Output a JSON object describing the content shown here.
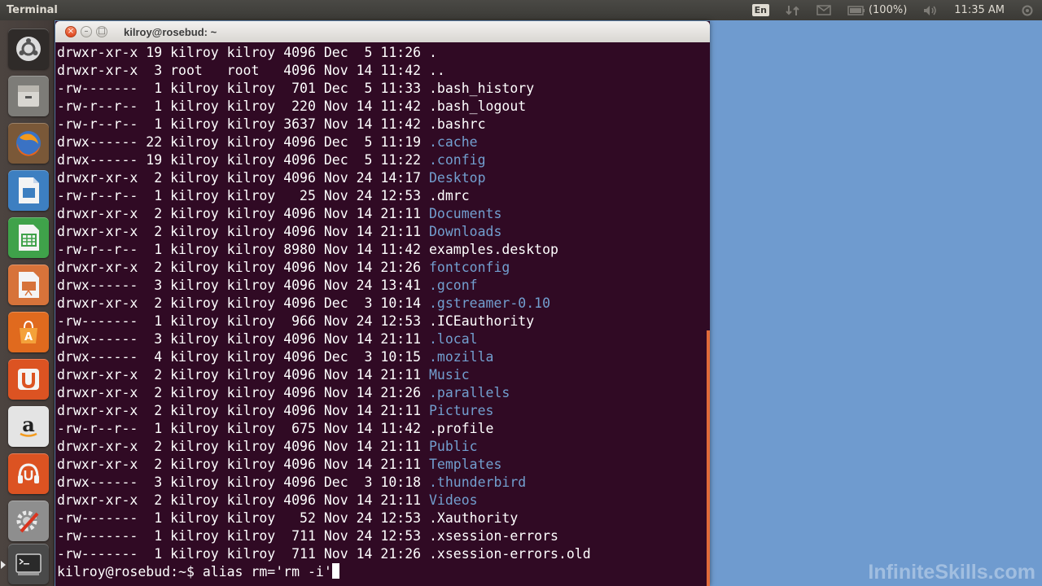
{
  "panel": {
    "app_title": "Terminal",
    "keyboard_layout": "En",
    "battery": "(100%)",
    "clock": "11:35 AM"
  },
  "launcher": {
    "items": [
      {
        "name": "dash-home",
        "icon": "ubuntu-logo-icon",
        "color": "#2b2b2b"
      },
      {
        "name": "files",
        "icon": "file-cabinet-icon",
        "color": "#8a8a86"
      },
      {
        "name": "firefox",
        "icon": "firefox-icon",
        "color": "#d9541f"
      },
      {
        "name": "libreoffice-writer",
        "icon": "writer-document-icon",
        "color": "#3d7fc1"
      },
      {
        "name": "libreoffice-calc",
        "icon": "calc-spreadsheet-icon",
        "color": "#3fa24a"
      },
      {
        "name": "libreoffice-impress",
        "icon": "impress-presentation-icon",
        "color": "#d7733a"
      },
      {
        "name": "software-center",
        "icon": "shopping-bag-icon",
        "color": "#e06a1e"
      },
      {
        "name": "ubuntu-one",
        "icon": "ubuntu-one-icon",
        "color": "#dc5322"
      },
      {
        "name": "amazon",
        "icon": "amazon-icon",
        "color": "#e8e8e8"
      },
      {
        "name": "ubuntu-one-music",
        "icon": "headphones-icon",
        "color": "#dc5322"
      },
      {
        "name": "system-settings",
        "icon": "gear-wrench-icon",
        "color": "#9a9a9a"
      },
      {
        "name": "terminal",
        "icon": "terminal-icon",
        "color": "#3a3a3a"
      }
    ]
  },
  "window": {
    "title": "kilroy@rosebud: ~"
  },
  "terminal": {
    "listing": [
      {
        "perms": "drwxr-xr-x",
        "links": "19",
        "owner": "kilroy",
        "group": "kilroy",
        "size": "4096",
        "date": "Dec  5 11:26",
        "name": ".",
        "is_dir": false
      },
      {
        "perms": "drwxr-xr-x",
        "links": " 3",
        "owner": "root",
        "group": "root",
        "size": "4096",
        "date": "Nov 14 11:42",
        "name": "..",
        "is_dir": false
      },
      {
        "perms": "-rw-------",
        "links": " 1",
        "owner": "kilroy",
        "group": "kilroy",
        "size": " 701",
        "date": "Dec  5 11:33",
        "name": ".bash_history",
        "is_dir": false
      },
      {
        "perms": "-rw-r--r--",
        "links": " 1",
        "owner": "kilroy",
        "group": "kilroy",
        "size": " 220",
        "date": "Nov 14 11:42",
        "name": ".bash_logout",
        "is_dir": false
      },
      {
        "perms": "-rw-r--r--",
        "links": " 1",
        "owner": "kilroy",
        "group": "kilroy",
        "size": "3637",
        "date": "Nov 14 11:42",
        "name": ".bashrc",
        "is_dir": false
      },
      {
        "perms": "drwx------",
        "links": "22",
        "owner": "kilroy",
        "group": "kilroy",
        "size": "4096",
        "date": "Dec  5 11:19",
        "name": ".cache",
        "is_dir": true
      },
      {
        "perms": "drwx------",
        "links": "19",
        "owner": "kilroy",
        "group": "kilroy",
        "size": "4096",
        "date": "Dec  5 11:22",
        "name": ".config",
        "is_dir": true
      },
      {
        "perms": "drwxr-xr-x",
        "links": " 2",
        "owner": "kilroy",
        "group": "kilroy",
        "size": "4096",
        "date": "Nov 24 14:17",
        "name": "Desktop",
        "is_dir": true
      },
      {
        "perms": "-rw-r--r--",
        "links": " 1",
        "owner": "kilroy",
        "group": "kilroy",
        "size": "  25",
        "date": "Nov 24 12:53",
        "name": ".dmrc",
        "is_dir": false
      },
      {
        "perms": "drwxr-xr-x",
        "links": " 2",
        "owner": "kilroy",
        "group": "kilroy",
        "size": "4096",
        "date": "Nov 14 21:11",
        "name": "Documents",
        "is_dir": true
      },
      {
        "perms": "drwxr-xr-x",
        "links": " 2",
        "owner": "kilroy",
        "group": "kilroy",
        "size": "4096",
        "date": "Nov 14 21:11",
        "name": "Downloads",
        "is_dir": true
      },
      {
        "perms": "-rw-r--r--",
        "links": " 1",
        "owner": "kilroy",
        "group": "kilroy",
        "size": "8980",
        "date": "Nov 14 11:42",
        "name": "examples.desktop",
        "is_dir": false
      },
      {
        "perms": "drwxr-xr-x",
        "links": " 2",
        "owner": "kilroy",
        "group": "kilroy",
        "size": "4096",
        "date": "Nov 14 21:26",
        "name": "fontconfig",
        "is_dir": true
      },
      {
        "perms": "drwx------",
        "links": " 3",
        "owner": "kilroy",
        "group": "kilroy",
        "size": "4096",
        "date": "Nov 24 13:41",
        "name": ".gconf",
        "is_dir": true
      },
      {
        "perms": "drwxr-xr-x",
        "links": " 2",
        "owner": "kilroy",
        "group": "kilroy",
        "size": "4096",
        "date": "Dec  3 10:14",
        "name": ".gstreamer-0.10",
        "is_dir": true
      },
      {
        "perms": "-rw-------",
        "links": " 1",
        "owner": "kilroy",
        "group": "kilroy",
        "size": " 966",
        "date": "Nov 24 12:53",
        "name": ".ICEauthority",
        "is_dir": false
      },
      {
        "perms": "drwx------",
        "links": " 3",
        "owner": "kilroy",
        "group": "kilroy",
        "size": "4096",
        "date": "Nov 14 21:11",
        "name": ".local",
        "is_dir": true
      },
      {
        "perms": "drwx------",
        "links": " 4",
        "owner": "kilroy",
        "group": "kilroy",
        "size": "4096",
        "date": "Dec  3 10:15",
        "name": ".mozilla",
        "is_dir": true
      },
      {
        "perms": "drwxr-xr-x",
        "links": " 2",
        "owner": "kilroy",
        "group": "kilroy",
        "size": "4096",
        "date": "Nov 14 21:11",
        "name": "Music",
        "is_dir": true
      },
      {
        "perms": "drwxr-xr-x",
        "links": " 2",
        "owner": "kilroy",
        "group": "kilroy",
        "size": "4096",
        "date": "Nov 14 21:26",
        "name": ".parallels",
        "is_dir": true
      },
      {
        "perms": "drwxr-xr-x",
        "links": " 2",
        "owner": "kilroy",
        "group": "kilroy",
        "size": "4096",
        "date": "Nov 14 21:11",
        "name": "Pictures",
        "is_dir": true
      },
      {
        "perms": "-rw-r--r--",
        "links": " 1",
        "owner": "kilroy",
        "group": "kilroy",
        "size": " 675",
        "date": "Nov 14 11:42",
        "name": ".profile",
        "is_dir": false
      },
      {
        "perms": "drwxr-xr-x",
        "links": " 2",
        "owner": "kilroy",
        "group": "kilroy",
        "size": "4096",
        "date": "Nov 14 21:11",
        "name": "Public",
        "is_dir": true
      },
      {
        "perms": "drwxr-xr-x",
        "links": " 2",
        "owner": "kilroy",
        "group": "kilroy",
        "size": "4096",
        "date": "Nov 14 21:11",
        "name": "Templates",
        "is_dir": true
      },
      {
        "perms": "drwx------",
        "links": " 3",
        "owner": "kilroy",
        "group": "kilroy",
        "size": "4096",
        "date": "Dec  3 10:18",
        "name": ".thunderbird",
        "is_dir": true
      },
      {
        "perms": "drwxr-xr-x",
        "links": " 2",
        "owner": "kilroy",
        "group": "kilroy",
        "size": "4096",
        "date": "Nov 14 21:11",
        "name": "Videos",
        "is_dir": true
      },
      {
        "perms": "-rw-------",
        "links": " 1",
        "owner": "kilroy",
        "group": "kilroy",
        "size": "  52",
        "date": "Nov 24 12:53",
        "name": ".Xauthority",
        "is_dir": false
      },
      {
        "perms": "-rw-------",
        "links": " 1",
        "owner": "kilroy",
        "group": "kilroy",
        "size": " 711",
        "date": "Nov 24 12:53",
        "name": ".xsession-errors",
        "is_dir": false
      },
      {
        "perms": "-rw-------",
        "links": " 1",
        "owner": "kilroy",
        "group": "kilroy",
        "size": " 711",
        "date": "Nov 14 21:26",
        "name": ".xsession-errors.old",
        "is_dir": false
      }
    ],
    "prompt": "kilroy@rosebud:~$ ",
    "command": "alias rm='rm -i'"
  },
  "watermark": "InfiniteSkills.com",
  "colors": {
    "terminal_bg": "#300a24",
    "directory": "#729fcf",
    "accent": "#e06a3a"
  }
}
